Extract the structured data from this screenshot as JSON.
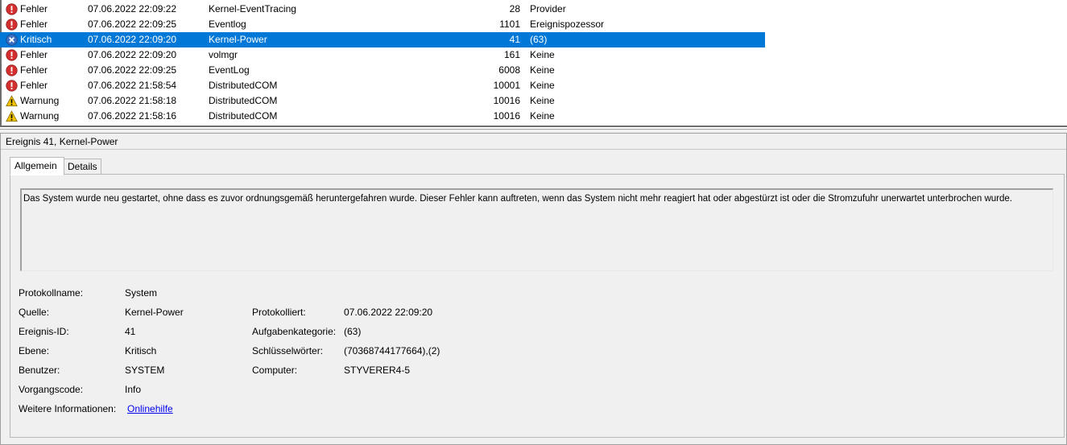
{
  "events": [
    {
      "level": "Fehler",
      "icon": "error-icon",
      "date": "07.06.2022 22:09:22",
      "source": "Kernel-EventTracing",
      "event_id": "28",
      "task": "Provider",
      "selected": false
    },
    {
      "level": "Fehler",
      "icon": "error-icon",
      "date": "07.06.2022 22:09:25",
      "source": "Eventlog",
      "event_id": "1101",
      "task": "Ereignispozessor",
      "selected": false
    },
    {
      "level": "Kritisch",
      "icon": "critical-icon",
      "date": "07.06.2022 22:09:20",
      "source": "Kernel-Power",
      "event_id": "41",
      "task": "(63)",
      "selected": true
    },
    {
      "level": "Fehler",
      "icon": "error-icon",
      "date": "07.06.2022 22:09:20",
      "source": "volmgr",
      "event_id": "161",
      "task": "Keine",
      "selected": false
    },
    {
      "level": "Fehler",
      "icon": "error-icon",
      "date": "07.06.2022 22:09:25",
      "source": "EventLog",
      "event_id": "6008",
      "task": "Keine",
      "selected": false
    },
    {
      "level": "Fehler",
      "icon": "error-icon",
      "date": "07.06.2022 21:58:54",
      "source": "DistributedCOM",
      "event_id": "10001",
      "task": "Keine",
      "selected": false
    },
    {
      "level": "Warnung",
      "icon": "warning-icon",
      "date": "07.06.2022 21:58:18",
      "source": "DistributedCOM",
      "event_id": "10016",
      "task": "Keine",
      "selected": false
    },
    {
      "level": "Warnung",
      "icon": "warning-icon",
      "date": "07.06.2022 21:58:16",
      "source": "DistributedCOM",
      "event_id": "10016",
      "task": "Keine",
      "selected": false
    }
  ],
  "detail": {
    "header": "Ereignis 41, Kernel-Power",
    "tabs": {
      "general": "Allgemein",
      "details": "Details"
    },
    "description": "Das System wurde neu gestartet, ohne dass es zuvor ordnungsgemäß heruntergefahren wurde. Dieser Fehler kann auftreten, wenn das System nicht mehr reagiert hat oder abgestürzt ist oder die Stromzufuhr unerwartet unterbrochen wurde.",
    "props": {
      "log_name_label": "Protokollname:",
      "log_name": "System",
      "source_label": "Quelle:",
      "source": "Kernel-Power",
      "logged_label": "Protokolliert:",
      "logged": "07.06.2022 22:09:20",
      "event_id_label": "Ereignis-ID:",
      "event_id": "41",
      "task_category_label": "Aufgabenkategorie:",
      "task_category": "(63)",
      "level_label": "Ebene:",
      "level": "Kritisch",
      "keywords_label": "Schlüsselwörter:",
      "keywords": "(70368744177664),(2)",
      "user_label": "Benutzer:",
      "user": "SYSTEM",
      "computer_label": "Computer:",
      "computer": "STYVERER4-5",
      "opcode_label": "Vorgangscode:",
      "opcode": "Info",
      "more_info_label": "Weitere Informationen:",
      "more_info_link": "Onlinehilfe"
    }
  },
  "colors": {
    "selection": "#0078d7",
    "error": "#d32f2f",
    "critical": "#3b6fc4",
    "warning": "#f3c300",
    "link": "#0000ee"
  }
}
